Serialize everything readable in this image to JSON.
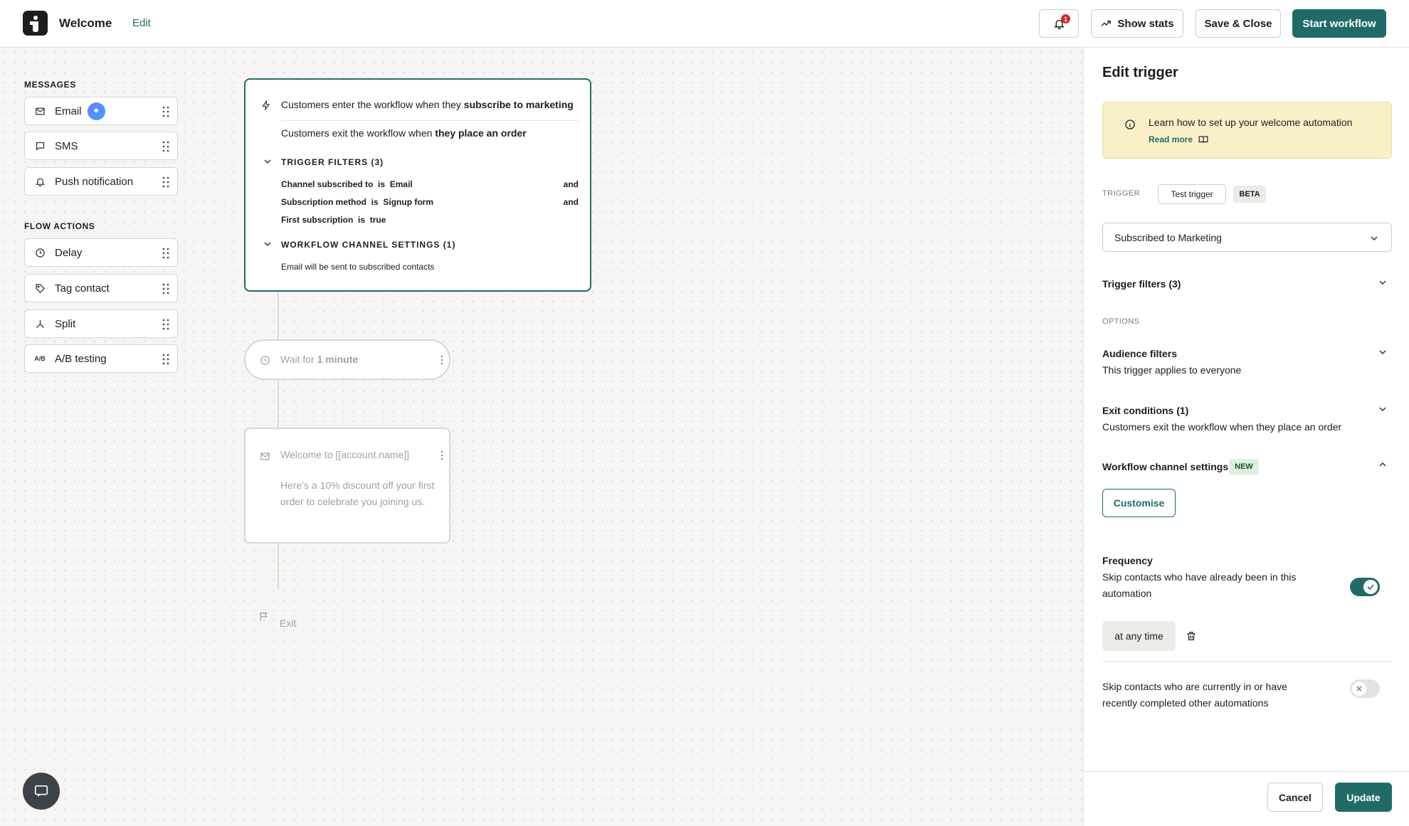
{
  "header": {
    "app_title": "Welcome",
    "edit_label": "Edit",
    "notification_count": "1",
    "show_stats_label": "Show stats",
    "save_close_label": "Save & Close",
    "start_workflow_label": "Start workflow"
  },
  "palette": {
    "messages_heading": "MESSAGES",
    "messages": [
      {
        "label": "Email",
        "icon": "mail-icon"
      },
      {
        "label": "SMS",
        "icon": "chat-bubble-icon"
      },
      {
        "label": "Push notification",
        "icon": "bell-icon"
      }
    ],
    "flow_heading": "FLOW ACTIONS",
    "flow_actions": [
      {
        "label": "Delay",
        "icon": "clock-icon"
      },
      {
        "label": "Tag contact",
        "icon": "tag-icon"
      },
      {
        "label": "Split",
        "icon": "split-icon"
      },
      {
        "label": "A/B testing",
        "icon": "ab-icon",
        "icon_text": "A/B"
      }
    ]
  },
  "trigger_card": {
    "enter_prefix": "Customers enter the workflow when they ",
    "enter_bold": "subscribe to marketing",
    "exit_prefix": "Customers exit the workflow when ",
    "exit_bold": "they place an order",
    "filters_heading": "TRIGGER FILTERS (3)",
    "filters": [
      {
        "field": "Channel subscribed to",
        "op": "is",
        "value": "Email",
        "join": "and"
      },
      {
        "field": "Subscription method",
        "op": "is",
        "value": "Signup form",
        "join": "and"
      },
      {
        "field": "First subscription",
        "op": "is",
        "value": "true",
        "join": ""
      }
    ],
    "channel_heading": "WORKFLOW CHANNEL SETTINGS (1)",
    "channel_note": "Email will be sent to subscribed contacts"
  },
  "wait_card": {
    "prefix": "Wait for ",
    "bold": "1 minute"
  },
  "email_card": {
    "title": "Welcome to [[account.name]]",
    "body": "Here's a 10% discount off your first order to celebrate you joining us."
  },
  "exit_label": "Exit",
  "panel": {
    "title": "Edit trigger",
    "info_text": "Learn how to set up your welcome automation",
    "read_more": "Read more",
    "trigger_label": "TRIGGER",
    "test_trigger": "Test trigger",
    "beta": "BETA",
    "selected_trigger": "Subscribed to Marketing",
    "trigger_filters": "Trigger filters (3)",
    "options_label": "OPTIONS",
    "audience_title": "Audience filters",
    "audience_sub": "This trigger applies to everyone",
    "exit_title": "Exit conditions (1)",
    "exit_sub": "Customers exit the workflow when they place an order",
    "channel_title": "Workflow channel settings",
    "new_badge": "NEW",
    "customise": "Customise",
    "frequency_title": "Frequency",
    "frequency_sub_1": "Skip contacts who have already been in this",
    "frequency_sub_2": "automation",
    "frequency_toggle_on": true,
    "at_any_time": "at any time",
    "skip_other_1": "Skip contacts who are currently in or have",
    "skip_other_2": "recently completed other automations",
    "skip_other_toggle_on": false,
    "cancel": "Cancel",
    "update": "Update"
  },
  "colors": {
    "accent": "#216b67",
    "notification": "#d62828",
    "info_bg": "#faf0c8"
  }
}
